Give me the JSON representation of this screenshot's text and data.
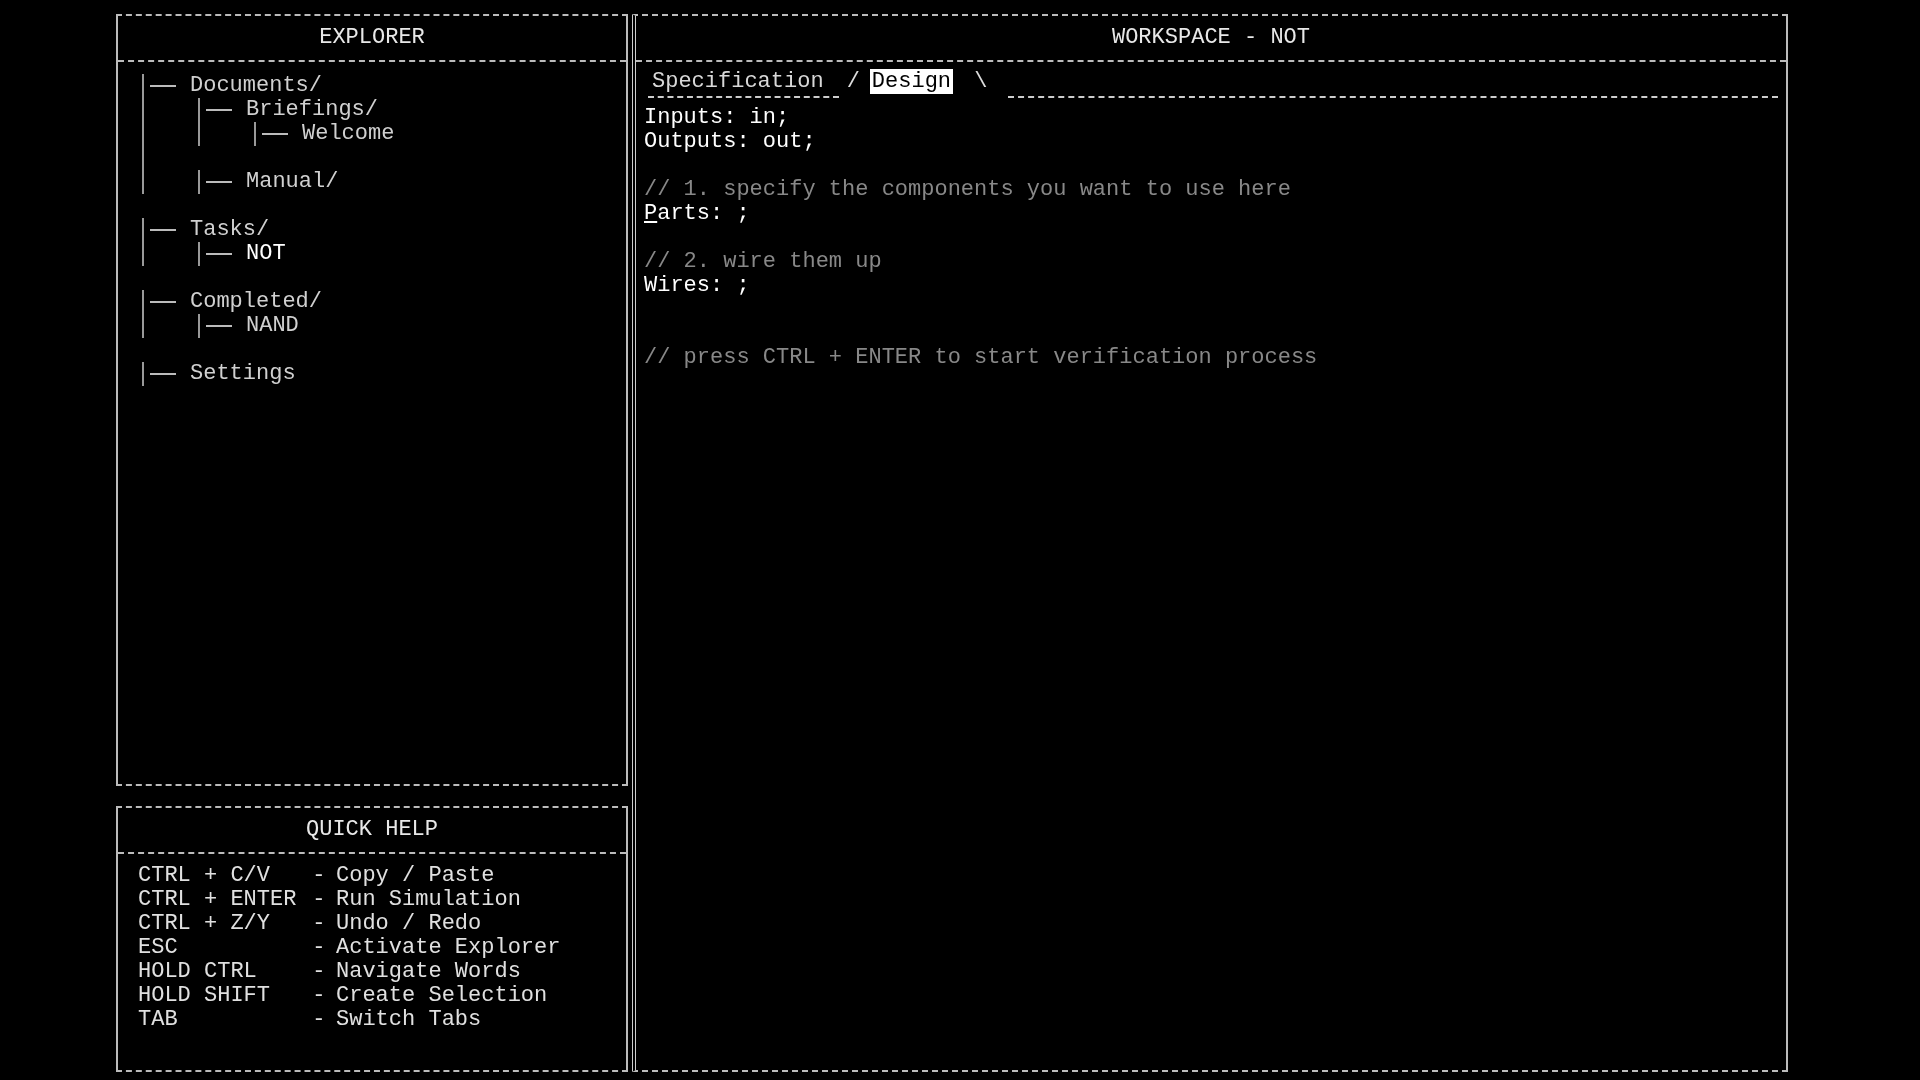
{
  "explorer": {
    "title": "EXPLORER",
    "tree": [
      {
        "label": "Documents/",
        "selected": false,
        "children": [
          {
            "label": "Briefings/",
            "selected": false,
            "children": [
              {
                "label": "Welcome",
                "selected": false
              }
            ]
          },
          {
            "label": "Manual/",
            "selected": false
          }
        ]
      },
      {
        "label": "Tasks/",
        "selected": false,
        "children": [
          {
            "label": "NOT",
            "selected": true
          }
        ]
      },
      {
        "label": "Completed/",
        "selected": false,
        "children": [
          {
            "label": "NAND",
            "selected": false
          }
        ]
      },
      {
        "label": "Settings",
        "selected": false
      }
    ]
  },
  "quick_help": {
    "title": "QUICK HELP",
    "shortcuts": [
      {
        "keys": "CTRL + C/V",
        "dash": "-",
        "action": "Copy / Paste"
      },
      {
        "keys": "CTRL + ENTER",
        "dash": "-",
        "action": "Run Simulation"
      },
      {
        "keys": "CTRL + Z/Y",
        "dash": "-",
        "action": "Undo / Redo"
      },
      {
        "keys": "ESC",
        "dash": "-",
        "action": "Activate Explorer"
      },
      {
        "keys": "HOLD CTRL",
        "dash": "-",
        "action": "Navigate Words"
      },
      {
        "keys": "HOLD SHIFT",
        "dash": "-",
        "action": "Create Selection"
      },
      {
        "keys": "TAB",
        "dash": "-",
        "action": "Switch Tabs"
      }
    ]
  },
  "workspace": {
    "title": "WORKSPACE - NOT",
    "tabs": [
      {
        "label": "Specification",
        "selected": false
      },
      {
        "label": "Design",
        "selected": true
      }
    ],
    "tab_divider": "/",
    "tab_end": "\\",
    "lines": [
      {
        "kind": "code",
        "text": "Inputs: in;",
        "cursor": false
      },
      {
        "kind": "code",
        "text": "Outputs: out;",
        "cursor": false
      },
      {
        "kind": "blank"
      },
      {
        "kind": "comment",
        "text": "// 1. specify the components you want to use here"
      },
      {
        "kind": "code",
        "text": "Parts: ;",
        "cursor": true
      },
      {
        "kind": "blank"
      },
      {
        "kind": "comment",
        "text": "// 2. wire them up"
      },
      {
        "kind": "code",
        "text": "Wires: ;",
        "cursor": false
      },
      {
        "kind": "blank"
      },
      {
        "kind": "blank"
      },
      {
        "kind": "comment",
        "text": "// press CTRL + ENTER to start verification process"
      }
    ]
  }
}
